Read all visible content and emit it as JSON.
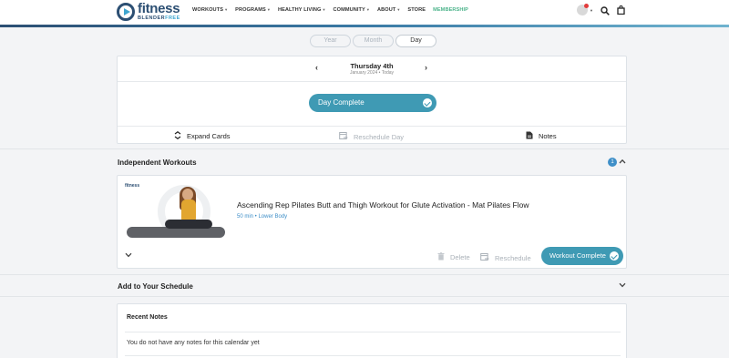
{
  "brand": {
    "name": "fitness",
    "sub_a": "BLENDER",
    "sub_b": "FREE"
  },
  "nav": [
    {
      "label": "WORKOUTS",
      "caret": true
    },
    {
      "label": "PROGRAMS",
      "caret": true
    },
    {
      "label": "HEALTHY LIVING",
      "caret": true
    },
    {
      "label": "COMMUNITY",
      "caret": true
    },
    {
      "label": "ABOUT",
      "caret": true
    },
    {
      "label": "STORE",
      "caret": false
    },
    {
      "label": "MEMBERSHIP",
      "caret": false
    }
  ],
  "view_tabs": {
    "year": "Year",
    "month": "Month",
    "day": "Day",
    "active": "Day"
  },
  "day": {
    "title": "Thursday 4th",
    "subtitle": "January 2024 • Today",
    "complete_label": "Day Complete",
    "actions": {
      "expand": "Expand Cards",
      "reschedule": "Reschedule Day",
      "notes": "Notes"
    }
  },
  "independent": {
    "title": "Independent Workouts",
    "count": "1",
    "workout": {
      "thumb_brand": "fitness",
      "title": "Ascending Rep Pilates Butt and Thigh Workout for Glute Activation - Mat Pilates Flow",
      "meta": "50 min • Lower Body",
      "delete": "Delete",
      "reschedule": "Reschedule",
      "complete": "Workout Complete"
    }
  },
  "add_schedule": {
    "title": "Add to Your Schedule"
  },
  "notes": {
    "title": "Recent Notes",
    "empty": "You do not have any notes for this calendar yet"
  },
  "colors": {
    "primary": "#3f9ab4",
    "navy": "#2c4f73",
    "membership": "#4bb38a",
    "badge": "#3f8fc8"
  }
}
